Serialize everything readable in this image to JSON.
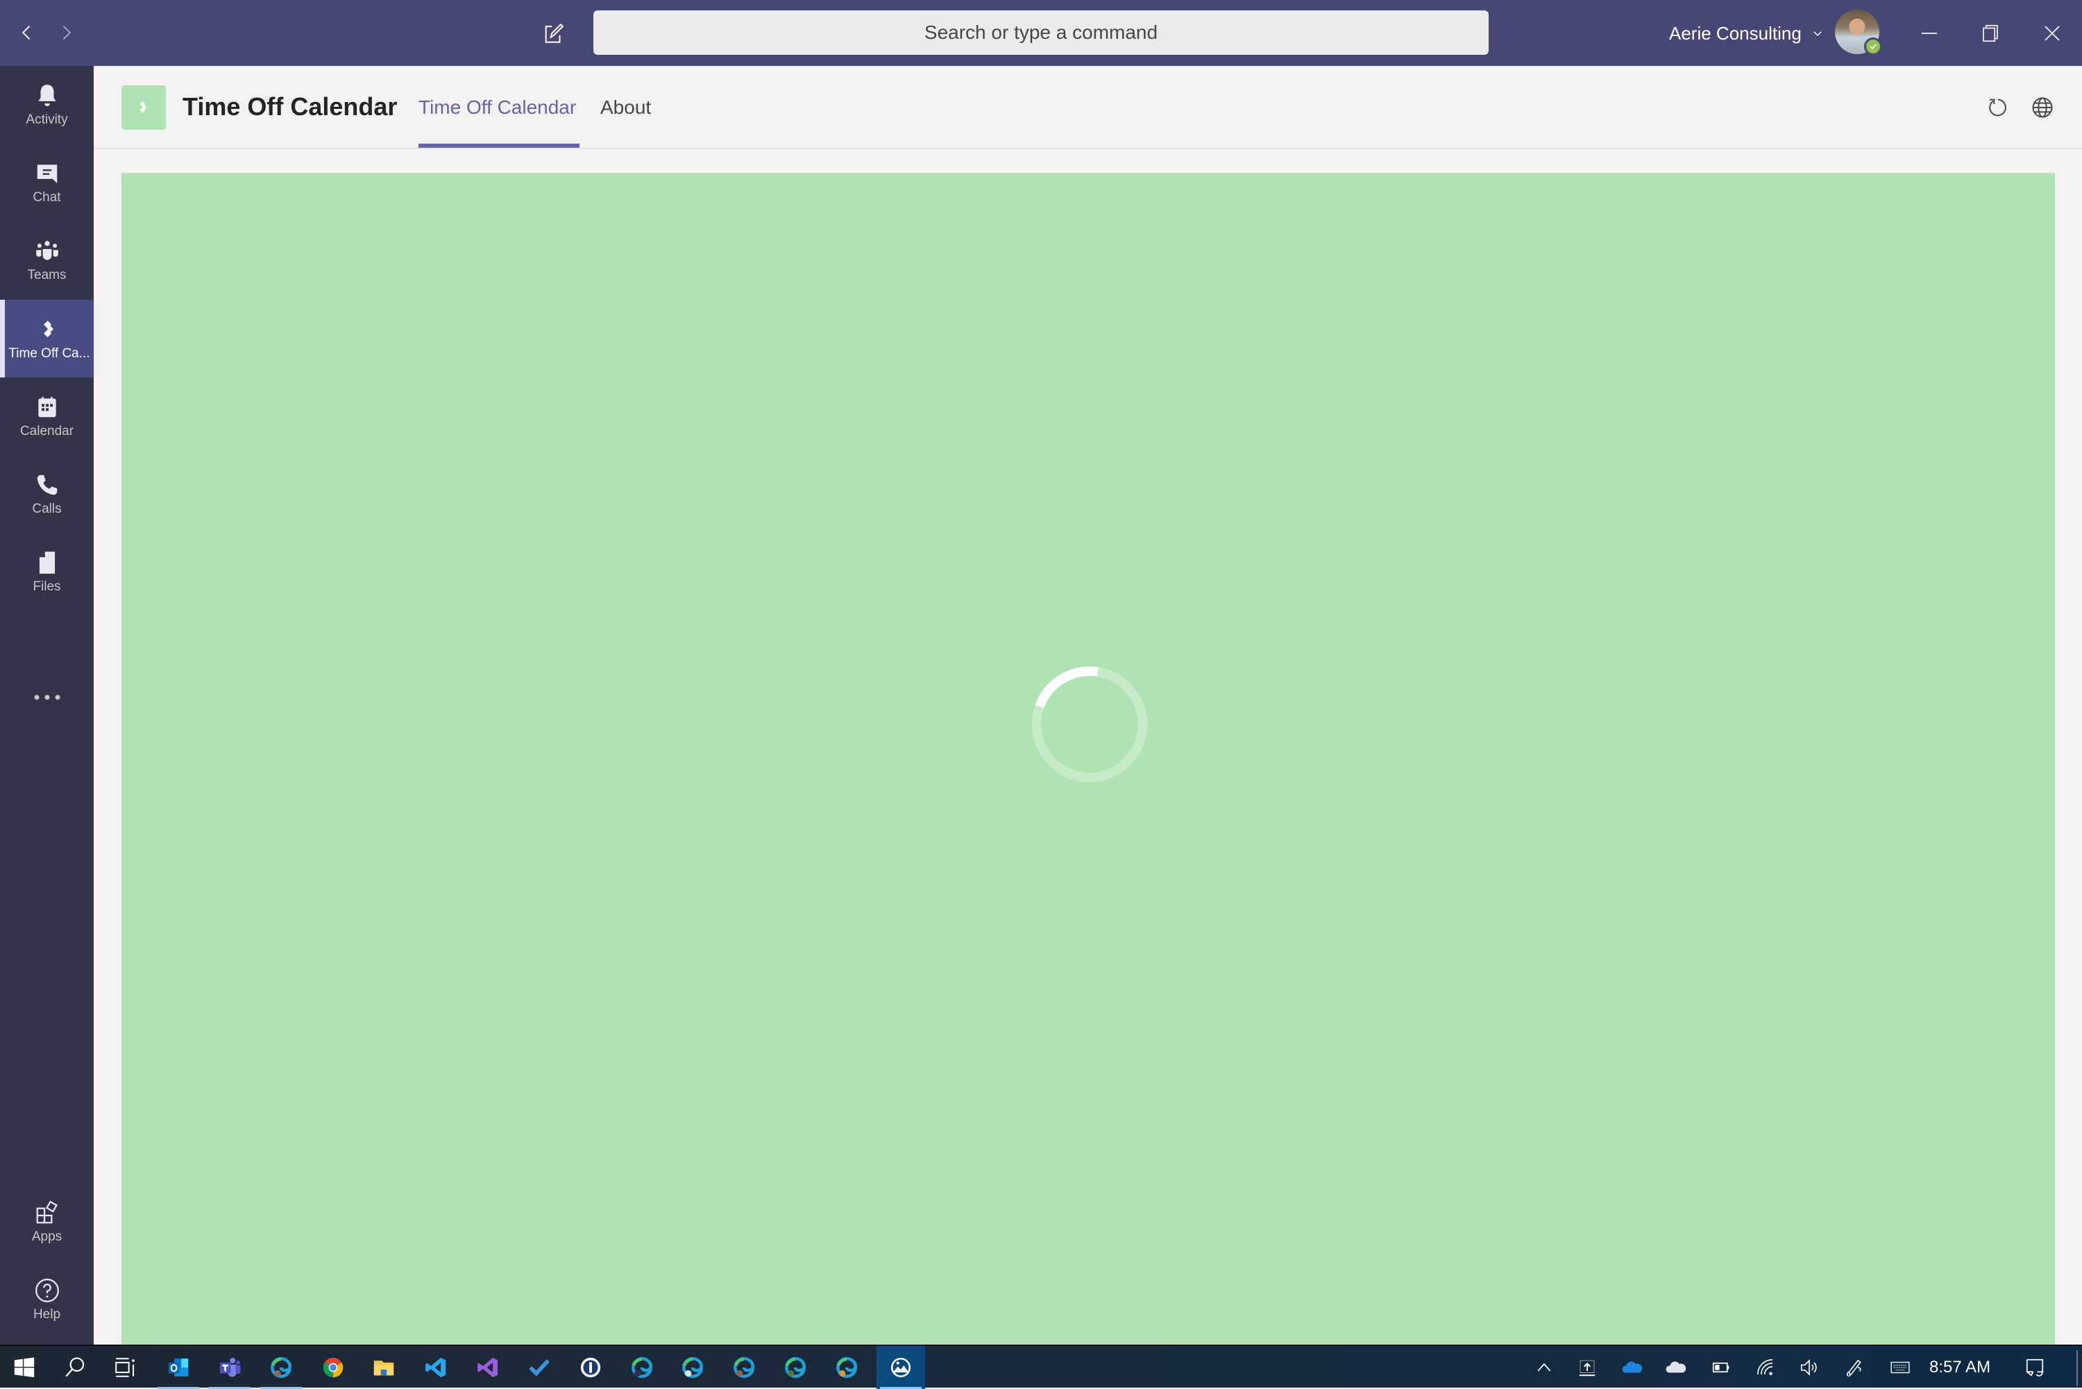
{
  "titlebar": {
    "back_icon": "chevron-left-icon",
    "forward_icon": "chevron-right-icon",
    "compose_icon": "compose-icon",
    "search": {
      "placeholder": "Search or type a command",
      "value": ""
    },
    "org_name": "Aerie Consulting",
    "org_chevron_icon": "chevron-down-icon",
    "presence_status": "available",
    "window_controls": {
      "minimize": "minimize-icon",
      "restore": "restore-icon",
      "close": "close-icon"
    }
  },
  "rail": {
    "items": [
      {
        "label": "Activity",
        "icon": "bell-icon",
        "active": false
      },
      {
        "label": "Chat",
        "icon": "chat-icon",
        "active": false
      },
      {
        "label": "Teams",
        "icon": "teams-icon",
        "active": false
      },
      {
        "label": "Time Off Ca...",
        "icon": "app-diamond-icon",
        "active": true
      },
      {
        "label": "Calendar",
        "icon": "calendar-icon",
        "active": false
      },
      {
        "label": "Calls",
        "icon": "phone-icon",
        "active": false
      },
      {
        "label": "Files",
        "icon": "file-icon",
        "active": false
      }
    ],
    "more_icon": "more-dots-icon",
    "bottom_items": [
      {
        "label": "Apps",
        "icon": "apps-icon"
      },
      {
        "label": "Help",
        "icon": "help-icon"
      }
    ]
  },
  "app_header": {
    "title": "Time Off Calendar",
    "tabs": [
      {
        "label": "Time Off Calendar",
        "active": true
      },
      {
        "label": "About",
        "active": false
      }
    ],
    "actions": [
      {
        "name": "reload",
        "icon": "refresh-icon"
      },
      {
        "name": "open-website",
        "icon": "globe-icon"
      }
    ]
  },
  "content": {
    "state": "loading",
    "spinner_icon": "loading-spinner-icon"
  },
  "colors": {
    "titlebar": "#464775",
    "rail": "#33344a",
    "rail_active": "#494b83",
    "accent": "#6264a7",
    "app_panel": "#b0e3b4",
    "presence_available": "#92c353"
  },
  "taskbar": {
    "apps": [
      {
        "name": "Start",
        "icon": "windows-start-icon",
        "running": false
      },
      {
        "name": "Search",
        "icon": "search-icon",
        "running": false
      },
      {
        "name": "Task View",
        "icon": "task-view-icon",
        "running": false
      },
      {
        "name": "Outlook",
        "icon": "outlook-icon",
        "running": true
      },
      {
        "name": "Microsoft Teams",
        "icon": "teams-app-icon",
        "running": true
      },
      {
        "name": "Microsoft Edge",
        "icon": "edge-icon",
        "running": true
      },
      {
        "name": "Google Chrome",
        "icon": "chrome-icon",
        "running": false
      },
      {
        "name": "File Explorer",
        "icon": "file-explorer-icon",
        "running": false
      },
      {
        "name": "Visual Studio Code",
        "icon": "vscode-icon",
        "running": false
      },
      {
        "name": "Visual Studio",
        "icon": "visual-studio-icon",
        "running": false
      },
      {
        "name": "Microsoft To Do",
        "icon": "todo-icon",
        "running": false
      },
      {
        "name": "1Password",
        "icon": "1password-icon",
        "running": false
      },
      {
        "name": "Edge Profile 1",
        "icon": "edge-profile-icon",
        "running": false
      },
      {
        "name": "Edge Profile 2",
        "icon": "edge-profile-icon",
        "running": false
      },
      {
        "name": "Edge Profile 3",
        "icon": "edge-profile-icon",
        "running": false
      },
      {
        "name": "Edge Profile 4",
        "icon": "edge-profile-icon",
        "running": false
      },
      {
        "name": "Edge Profile 5",
        "icon": "edge-profile-icon",
        "running": false
      },
      {
        "name": "Snip & Sketch",
        "icon": "snip-sketch-icon",
        "running": true
      }
    ],
    "tray": [
      {
        "name": "Show hidden icons",
        "icon": "chevron-up-icon"
      },
      {
        "name": "Upload",
        "icon": "upload-icon"
      },
      {
        "name": "OneDrive",
        "icon": "onedrive-icon"
      },
      {
        "name": "OneDrive Personal",
        "icon": "onedrive-grey-icon"
      },
      {
        "name": "Battery",
        "icon": "battery-icon"
      },
      {
        "name": "Network",
        "icon": "wifi-icon"
      },
      {
        "name": "Volume",
        "icon": "volume-icon"
      },
      {
        "name": "Pen",
        "icon": "pen-icon"
      },
      {
        "name": "Touch keyboard",
        "icon": "keyboard-icon"
      }
    ],
    "clock": "8:57 AM",
    "notifications_icon": "action-center-icon"
  }
}
